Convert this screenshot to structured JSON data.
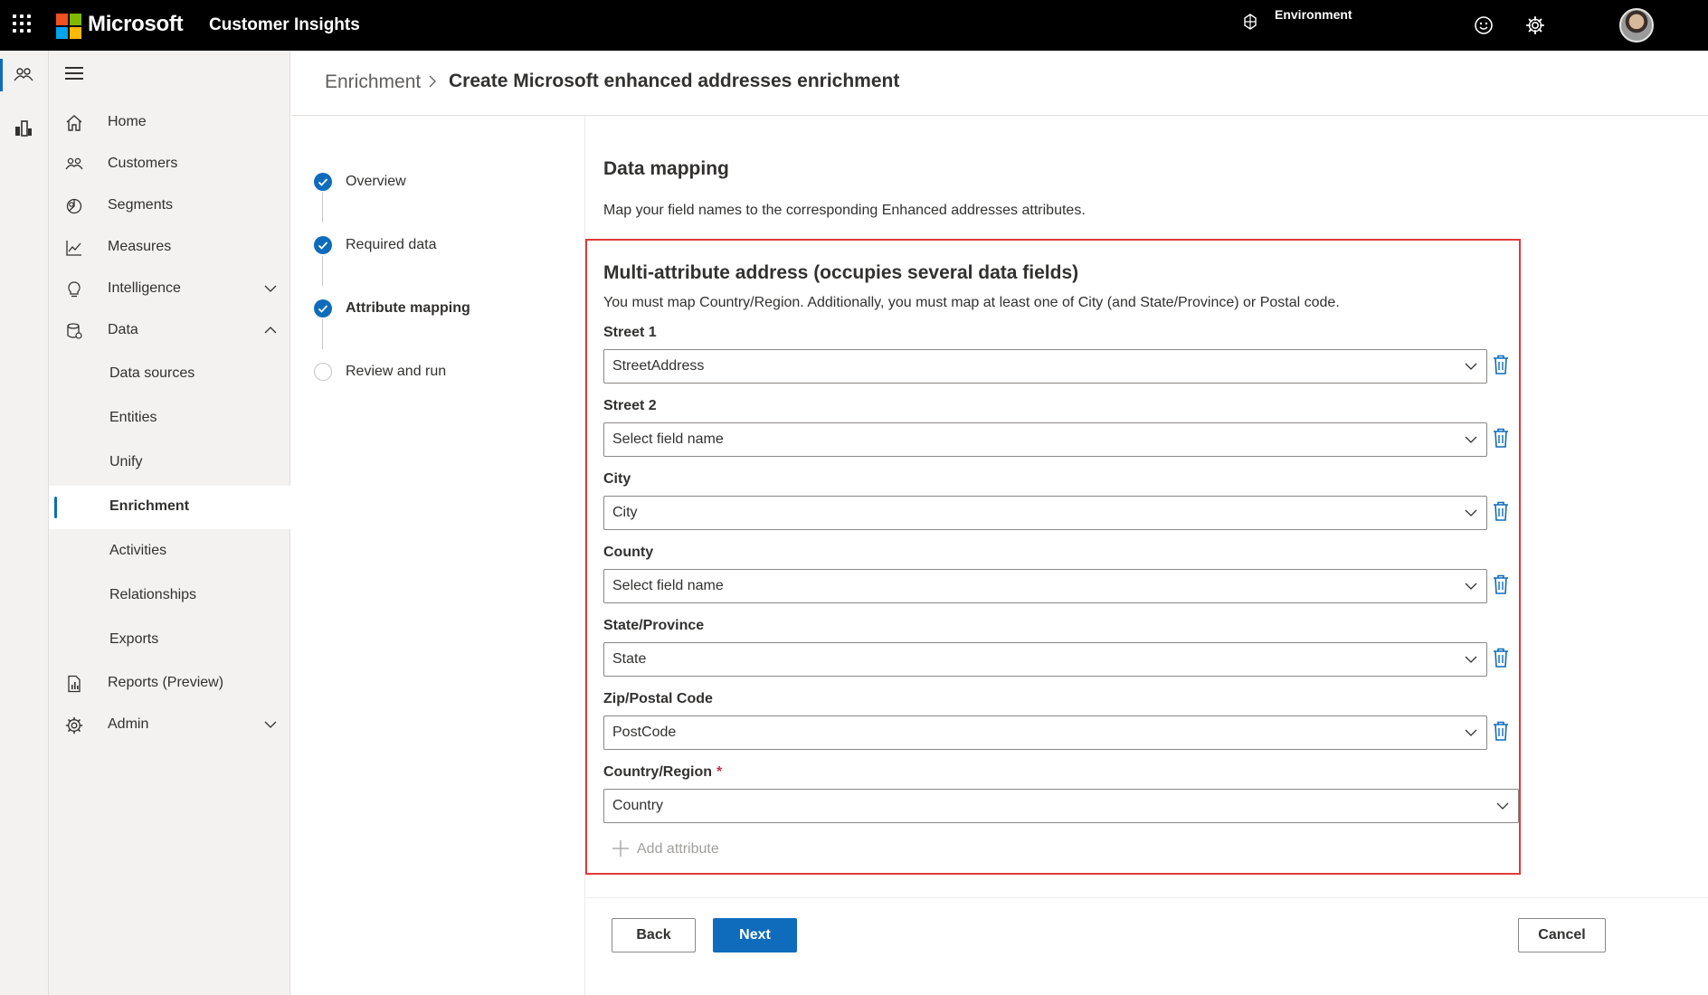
{
  "topbar": {
    "brand": "Microsoft",
    "app_name": "Customer Insights",
    "environment_label": "Environment"
  },
  "sidenav": {
    "items": [
      {
        "label": "Home",
        "icon": "home-icon"
      },
      {
        "label": "Customers",
        "icon": "people-icon"
      },
      {
        "label": "Segments",
        "icon": "segments-icon"
      },
      {
        "label": "Measures",
        "icon": "chart-line-icon"
      },
      {
        "label": "Intelligence",
        "icon": "lightbulb-icon",
        "expandable": true,
        "expanded": false
      },
      {
        "label": "Data",
        "icon": "database-icon",
        "expandable": true,
        "expanded": true
      },
      {
        "label": "Reports (Preview)",
        "icon": "report-icon"
      },
      {
        "label": "Admin",
        "icon": "gear-icon",
        "expandable": true,
        "expanded": false
      }
    ],
    "data_children": [
      {
        "label": "Data sources"
      },
      {
        "label": "Entities"
      },
      {
        "label": "Unify"
      },
      {
        "label": "Enrichment",
        "active": true
      },
      {
        "label": "Activities"
      },
      {
        "label": "Relationships"
      },
      {
        "label": "Exports"
      }
    ]
  },
  "breadcrumb": {
    "parent": "Enrichment",
    "current": "Create Microsoft enhanced addresses enrichment"
  },
  "steps": [
    {
      "label": "Overview",
      "status": "done"
    },
    {
      "label": "Required data",
      "status": "done"
    },
    {
      "label": "Attribute mapping",
      "status": "current"
    },
    {
      "label": "Review and run",
      "status": "pending"
    }
  ],
  "section": {
    "title": "Data mapping",
    "description": "Map your field names to the corresponding Enhanced addresses attributes."
  },
  "panel": {
    "title": "Multi-attribute address (occupies several data fields)",
    "description": "You must map Country/Region. Additionally, you must map at least one of City (and State/Province) or Postal code.",
    "fields": [
      {
        "label": "Street 1",
        "value": "StreetAddress",
        "required": false
      },
      {
        "label": "Street 2",
        "value": "Select field name",
        "required": false
      },
      {
        "label": "City",
        "value": "City",
        "required": false
      },
      {
        "label": "County",
        "value": "Select field name",
        "required": false
      },
      {
        "label": "State/Province",
        "value": "State",
        "required": false
      },
      {
        "label": "Zip/Postal Code",
        "value": "PostCode",
        "required": false
      },
      {
        "label": "Country/Region",
        "value": "Country",
        "required": true
      }
    ],
    "required_marker": "*",
    "add_attribute_label": "Add attribute"
  },
  "footer": {
    "back_label": "Back",
    "next_label": "Next",
    "cancel_label": "Cancel"
  },
  "colors": {
    "accent": "#0f6cbd",
    "highlight_border": "#e03a3a",
    "topbar_bg": "#000000",
    "nav_bg": "#f3f2f1"
  }
}
